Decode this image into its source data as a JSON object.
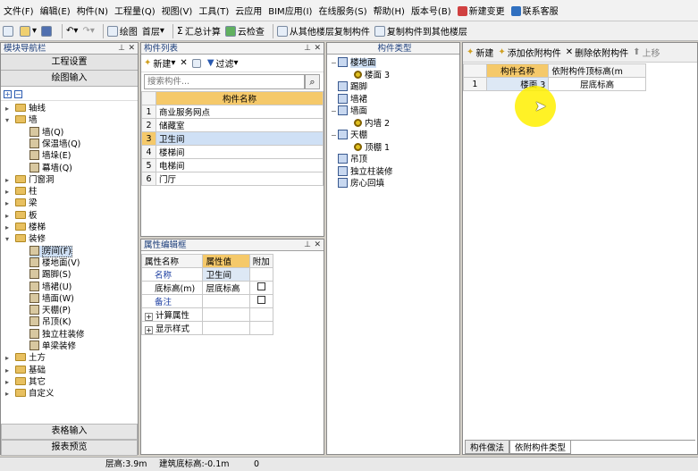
{
  "menu": [
    "文件(F)",
    "编辑(E)",
    "构件(N)",
    "工程量(Q)",
    "视图(V)",
    "工具(T)",
    "云应用",
    "BIM应用(I)",
    "在线服务(S)",
    "帮助(H)",
    "版本号(B)",
    "新建变更",
    "联系客服"
  ],
  "toolbar": {
    "draw": "绘图",
    "floor": "首层",
    "sum": "汇总计算",
    "cloud": "云检查",
    "copy_from": "从其他楼层复制构件",
    "copy_to": "复制构件到其他楼层"
  },
  "nav": {
    "title": "模块导航栏",
    "top_btn": "工程设置",
    "top_btn2": "绘图输入",
    "tree": [
      {
        "label": "轴线",
        "level": 0,
        "open": false
      },
      {
        "label": "墙",
        "level": 0,
        "open": true
      },
      {
        "label": "墙(Q)",
        "level": 1
      },
      {
        "label": "保温墙(Q)",
        "level": 1
      },
      {
        "label": "墙垛(E)",
        "level": 1
      },
      {
        "label": "幕墙(Q)",
        "level": 1
      },
      {
        "label": "门窗洞",
        "level": 0,
        "open": false
      },
      {
        "label": "柱",
        "level": 0,
        "open": false
      },
      {
        "label": "梁",
        "level": 0,
        "open": false
      },
      {
        "label": "板",
        "level": 0,
        "open": false
      },
      {
        "label": "楼梯",
        "level": 0,
        "open": false
      },
      {
        "label": "装修",
        "level": 0,
        "open": true
      },
      {
        "label": "房间(F)",
        "level": 1,
        "selected": true
      },
      {
        "label": "楼地面(V)",
        "level": 1
      },
      {
        "label": "踢脚(S)",
        "level": 1
      },
      {
        "label": "墙裙(U)",
        "level": 1
      },
      {
        "label": "墙面(W)",
        "level": 1
      },
      {
        "label": "天棚(P)",
        "level": 1
      },
      {
        "label": "吊顶(K)",
        "level": 1
      },
      {
        "label": "独立柱装修",
        "level": 1
      },
      {
        "label": "单梁装修",
        "level": 1
      },
      {
        "label": "土方",
        "level": 0,
        "open": false
      },
      {
        "label": "基础",
        "level": 0,
        "open": false
      },
      {
        "label": "其它",
        "level": 0,
        "open": false
      },
      {
        "label": "自定义",
        "level": 0,
        "open": false
      }
    ],
    "bottom_btn1": "表格输入",
    "bottom_btn2": "报表预览"
  },
  "complist": {
    "title": "构件列表",
    "new_btn": "新建",
    "filter_btn": "过滤",
    "search_placeholder": "搜索构件...",
    "header": "构件名称",
    "rows": [
      "商业服务网点",
      "储藏室",
      "卫生间",
      "楼梯间",
      "电梯间",
      "门厅"
    ],
    "selected": 2
  },
  "props": {
    "title": "属性编辑框",
    "headers": [
      "属性名称",
      "属性值",
      "附加"
    ],
    "rows": [
      {
        "name": "名称",
        "value": "卫生间",
        "check": false,
        "blue": true
      },
      {
        "name": "底标高(m)",
        "value": "层底标高",
        "check": true
      },
      {
        "name": "备注",
        "value": "",
        "check": true,
        "blue": true
      },
      {
        "name": "计算属性",
        "value": "",
        "expand": true
      },
      {
        "name": "显示样式",
        "value": "",
        "expand": true
      }
    ]
  },
  "comptype": {
    "title": "构件类型",
    "items": [
      {
        "label": "楼地面",
        "level": 0
      },
      {
        "label": "楼面 3",
        "level": 1
      },
      {
        "label": "踢脚",
        "level": 0
      },
      {
        "label": "墙裙",
        "level": 0
      },
      {
        "label": "墙面",
        "level": 0
      },
      {
        "label": "内墙 2",
        "level": 1
      },
      {
        "label": "天棚",
        "level": 0
      },
      {
        "label": "顶棚 1",
        "level": 1
      },
      {
        "label": "吊顶",
        "level": 0
      },
      {
        "label": "独立柱装修",
        "level": 0
      },
      {
        "label": "房心回填",
        "level": 0
      }
    ]
  },
  "depend": {
    "new_btn": "新建",
    "add_btn": "添加依附构件",
    "del_btn": "删除依附构件",
    "up_btn": "上移",
    "headers": [
      "构件名称",
      "依附构件顶标高(m"
    ],
    "rows": [
      {
        "num": "1",
        "name": "楼面 3",
        "elev": "层底标高"
      }
    ],
    "tabs": [
      "构件做法",
      "依附构件类型"
    ]
  },
  "status": {
    "floor_height": "层高:3.9m",
    "base_elev": "建筑底标高:-0.1m",
    "zero": "0"
  }
}
